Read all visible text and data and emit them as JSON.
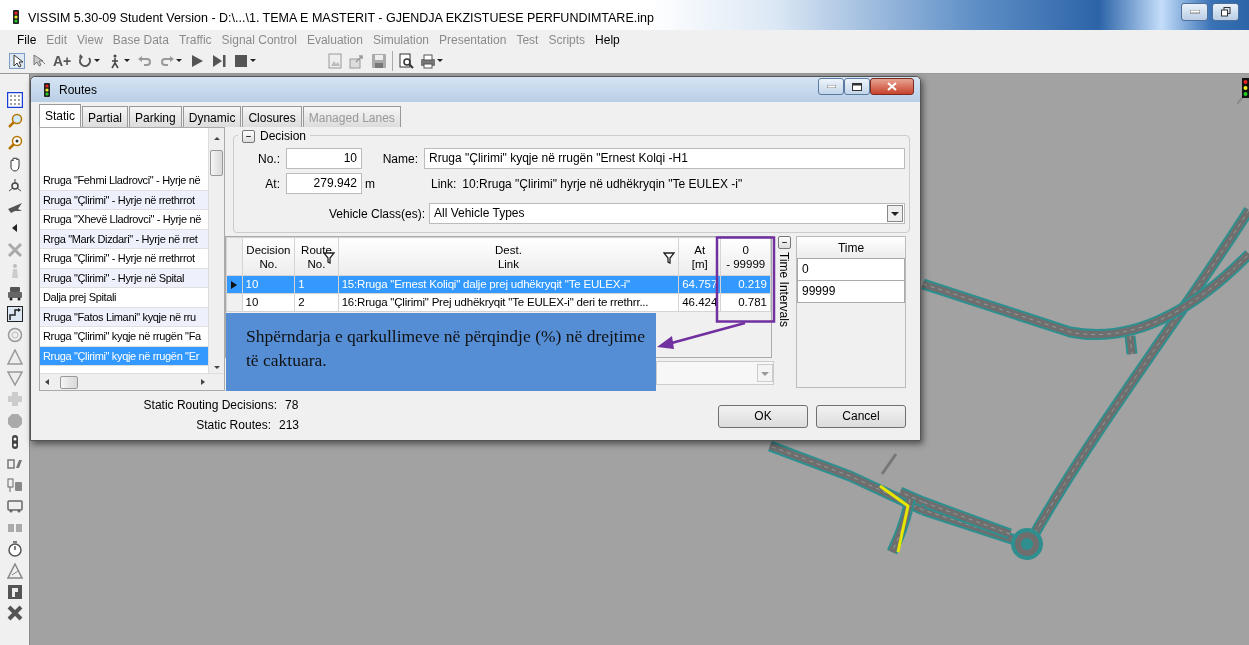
{
  "window": {
    "title": "VISSIM 5.30-09 Student Version - D:\\...\\1. TEMA E MASTERIT - GJENDJA EKZISTUESE PERFUNDIMTARE.inp"
  },
  "menu": [
    {
      "label": "File",
      "disabled": false
    },
    {
      "label": "Edit",
      "disabled": true
    },
    {
      "label": "View",
      "disabled": true
    },
    {
      "label": "Base Data",
      "disabled": true
    },
    {
      "label": "Traffic",
      "disabled": true
    },
    {
      "label": "Signal Control",
      "disabled": true
    },
    {
      "label": "Evaluation",
      "disabled": true
    },
    {
      "label": "Simulation",
      "disabled": true
    },
    {
      "label": "Presentation",
      "disabled": true
    },
    {
      "label": "Test",
      "disabled": true
    },
    {
      "label": "Scripts",
      "disabled": true
    },
    {
      "label": "Help",
      "disabled": false
    }
  ],
  "toolbar": {
    "text_tool": "A+"
  },
  "dialog": {
    "title": "Routes",
    "tabs": [
      {
        "label": "Static",
        "selected": true,
        "disabled": false
      },
      {
        "label": "Partial",
        "selected": false,
        "disabled": false
      },
      {
        "label": "Parking",
        "selected": false,
        "disabled": false
      },
      {
        "label": "Dynamic",
        "selected": false,
        "disabled": false
      },
      {
        "label": "Closures",
        "selected": false,
        "disabled": false
      },
      {
        "label": "Managed Lanes",
        "selected": false,
        "disabled": true
      }
    ],
    "route_list": [
      {
        "label": "Rruga \"Fehmi Lladrovci\" - Hyrje në",
        "selected": false
      },
      {
        "label": "Rruga \"Çlirimi\" - Hyrje në rrethrrot",
        "selected": false
      },
      {
        "label": "Rruga \"Xhevë Lladrovci\" - Hyrje në",
        "selected": false
      },
      {
        "label": "Rrga \"Mark Dizdari\" - Hyrje në rret",
        "selected": false
      },
      {
        "label": "Rruga \"Çlirimi\" - Hyrje në rrethrrot",
        "selected": false
      },
      {
        "label": "Rruga \"Çlirimi\" - Hyrje në Spital",
        "selected": false
      },
      {
        "label": "Dalja prej Spitali",
        "selected": false
      },
      {
        "label": "Rruga \"Fatos Limani\" kyqje në rru",
        "selected": false
      },
      {
        "label": "Rruga \"Çlirimi\" kyqje në rrugën \"Fa",
        "selected": false
      },
      {
        "label": "Rruga \"Çlirimi\" kyqje në rrugën \"Er",
        "selected": true
      }
    ],
    "decision": {
      "legend": "Decision",
      "no_label": "No.:",
      "no": "10",
      "at_label": "At:",
      "at": "279.942",
      "at_unit": "m",
      "name_label": "Name:",
      "name": "Rruga \"Çlirimi\" kyqje në rrugën \"Ernest Kolqi -H1",
      "link_label": "Link:",
      "link": "10:Rruga \"Çlirimi\" hyrje në udhëkryqin \"Te EULEX -i\"",
      "vehicle_label": "Vehicle Class(es):",
      "vehicle_value": "All Vehicle Types"
    },
    "routes_table": {
      "columns": [
        {
          "label": "Decision\nNo.",
          "filter": false
        },
        {
          "label": "Route\nNo.",
          "filter": true
        },
        {
          "label": "Dest.\nLink",
          "filter": true
        },
        {
          "label": "At\n[m]",
          "filter": false
        },
        {
          "label": "0\n- 99999",
          "filter": false
        }
      ],
      "rows": [
        {
          "cells": [
            "10",
            "1",
            "15:Rruga \"Ernest Koliqi\" dalje prej udhëkryqit \"Te EULEX-i\"",
            "64.757",
            "0.219"
          ],
          "selected": true
        },
        {
          "cells": [
            "10",
            "2",
            "16:Rruga \"Çlirimi\" Prej udhëkryqit \"Te EULEX-i\" deri te rrethrr...",
            "46.424",
            "0.781"
          ],
          "selected": false
        }
      ]
    },
    "time_intervals": {
      "label": "Time Intervals",
      "column": "Time",
      "rows": [
        "0",
        "99999"
      ]
    },
    "stats": [
      {
        "label": "Static Routing Decisions:",
        "value": "78"
      },
      {
        "label": "Static Routes:",
        "value": "213"
      }
    ],
    "buttons": [
      "OK",
      "Cancel"
    ]
  },
  "annotation": {
    "text": "Shpërndarja e qarkullimeve në përqindje (%) në drejtime të caktuara."
  }
}
